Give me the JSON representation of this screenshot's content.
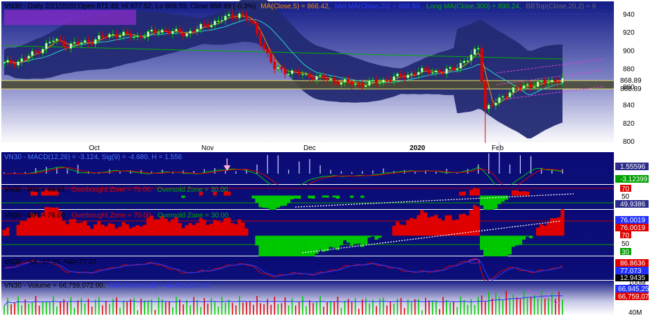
{
  "colors": {
    "panel_bg": "#0c0c78",
    "axis_bg": "#ffffff",
    "up": "#00c800",
    "down": "#e00000",
    "band": "#232a73",
    "ma_short": "#ff8c00",
    "ma_long": "#00b000",
    "trend": "#ffffff",
    "channel": "#e040e0"
  },
  "price": {
    "header": {
      "ticker": "VN30 - Daily 2/21/2020 Open 871.49, Hi 877.52, Lo 868.59, Close 868.89 (-0.3%)",
      "ma5": "MA(Close,5) = 866.42,",
      "mid_ma": "Mid MA(Close,20) = 888.89,",
      "long_ma": "Long MA(Close,300) = 890.24,",
      "bbtop": "BBTop(Close,20,2) = 9"
    },
    "ticks": [
      "940",
      "920",
      "900",
      "880",
      "860",
      "840",
      "820",
      "800"
    ],
    "last_labels": [
      "868.89",
      "868.89"
    ]
  },
  "x_axis": [
    "Oct",
    "Nov",
    "Dec",
    "2020",
    "Feb"
  ],
  "macd": {
    "header": "VN30 - MACD(12,26) = -3.124, Sig(9) = -4.680, H = 1.556",
    "labels": [
      "1.55596",
      "-3.12399"
    ]
  },
  "rsi": {
    "header": {
      "name": "VN30 - RSI = 49.94,",
      "ob": "Overbought Zone = 70.00,",
      "os": "Oversold Zone = 30.00"
    },
    "labels": [
      "70",
      "50",
      "49.9386"
    ]
  },
  "mfi": {
    "header": {
      "name": "VN30 - MFI = 76.00,",
      "ob": "Overbought Zone = 70.00,",
      "os": "Oversold Zone = 30.00"
    },
    "labels": [
      "76.0019",
      "76.0019",
      "70",
      "50",
      "30"
    ]
  },
  "stoch": {
    "header": "VN30 - %K=86.86, %D=77.07",
    "labels": [
      "86.8636",
      "77.073",
      "12.9435"
    ]
  },
  "volume": {
    "header": {
      "name": "VN30 - Volume = 66,759,072.00,",
      "ma": "MA(Volume,20) = 66,945,256.00"
    },
    "labels": [
      "100M",
      "66,945,25",
      "66,759,07",
      "40M"
    ]
  },
  "chart_data": [
    {
      "type": "candlestick",
      "title": "VN30 - Daily 2/21/2020",
      "series": [
        {
          "name": "Close",
          "x": [
            "2019-09-23",
            "2019-10-01",
            "2019-10-15",
            "2019-11-01",
            "2019-11-07",
            "2019-11-20",
            "2019-12-02",
            "2019-12-15",
            "2020-01-02",
            "2020-01-20",
            "2020-01-31",
            "2020-02-06",
            "2020-02-21"
          ],
          "values": [
            885,
            900,
            915,
            925,
            940,
            895,
            875,
            862,
            872,
            895,
            830,
            855,
            868.89
          ]
        },
        {
          "name": "MA(Close,300)",
          "values": [
            905,
            890.24
          ]
        }
      ],
      "ylim": [
        795,
        950
      ]
    },
    {
      "type": "line",
      "title": "VN30 - MACD(12,26)",
      "series": [
        {
          "name": "H",
          "values": [
            1.556
          ]
        }
      ]
    },
    {
      "type": "area",
      "title": "VN30 - RSI",
      "series": [
        {
          "name": "RSI",
          "values": [
            49.94
          ]
        }
      ],
      "ylim": [
        0,
        100
      ]
    },
    {
      "type": "area",
      "title": "VN30 - MFI",
      "series": [
        {
          "name": "MFI",
          "values": [
            76.0
          ]
        }
      ],
      "ylim": [
        0,
        100
      ]
    },
    {
      "type": "line",
      "title": "VN30 - Stochastic",
      "series": [
        {
          "name": "%K",
          "values": [
            86.86
          ]
        },
        {
          "name": "%D",
          "values": [
            77.07
          ]
        }
      ]
    },
    {
      "type": "bar",
      "title": "VN30 - Volume",
      "series": [
        {
          "name": "Volume",
          "values": [
            66759072
          ]
        },
        {
          "name": "MA(Volume,20)",
          "values": [
            66945256
          ]
        }
      ]
    }
  ]
}
